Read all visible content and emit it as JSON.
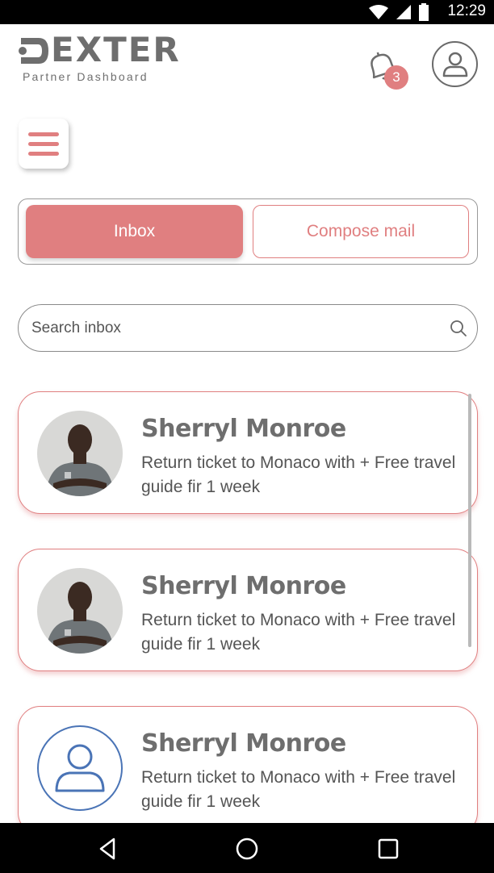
{
  "status_bar": {
    "time": "12:29",
    "icons": [
      "wifi-icon",
      "signal-icon",
      "battery-icon"
    ]
  },
  "header": {
    "logo_text": "DEXTER",
    "logo_subtitle": "Partner Dashboard",
    "notification_count": "3"
  },
  "tabs": {
    "inbox_label": "Inbox",
    "compose_label": "Compose mail",
    "active": "inbox"
  },
  "search": {
    "placeholder": "Search inbox"
  },
  "mails": [
    {
      "name": "Sherryl Monroe",
      "preview": "Return ticket to Monaco with + Free travel guide fir 1 week",
      "avatar": "photo"
    },
    {
      "name": "Sherryl Monroe",
      "preview": "Return ticket to Monaco with + Free travel guide fir 1 week",
      "avatar": "photo"
    },
    {
      "name": "Sherryl Monroe",
      "preview": "Return ticket to Monaco with + Free travel guide fir 1 week",
      "avatar": "placeholder"
    }
  ],
  "colors": {
    "accent": "#e07f80",
    "text": "#6e6e6e",
    "placeholder_avatar": "#4a74b6"
  }
}
